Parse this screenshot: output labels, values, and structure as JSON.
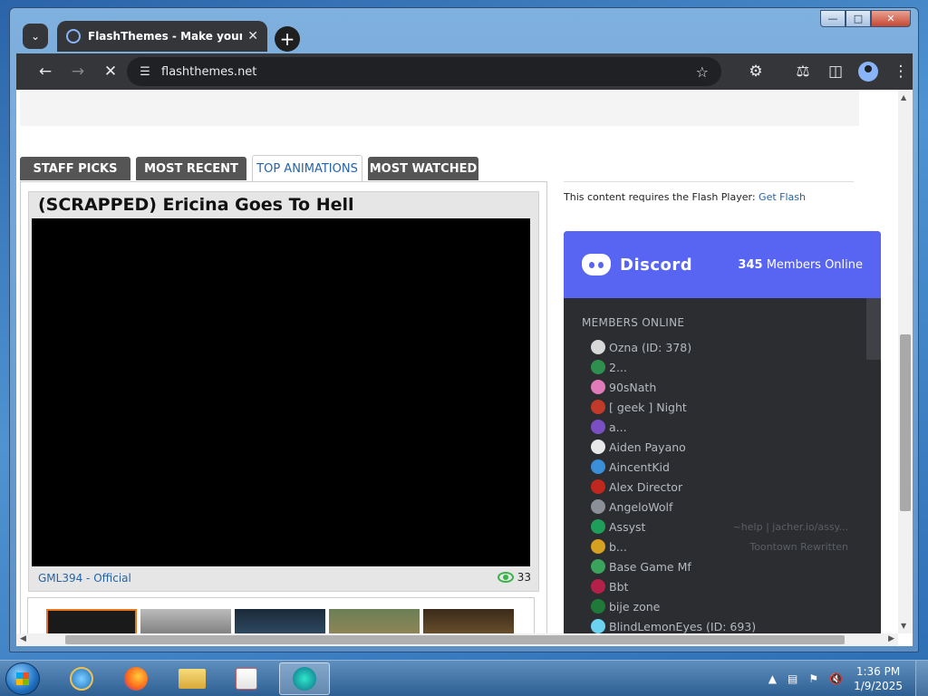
{
  "browser": {
    "tab_title": "FlashThemes - Make your own",
    "url": "flashthemes.net"
  },
  "site": {
    "tabs": [
      "STAFF PICKS",
      "MOST RECENT",
      "TOP ANIMATIONS",
      "MOST WATCHED"
    ],
    "active_tab": "TOP ANIMATIONS",
    "video": {
      "title": "(SCRAPPED) Ericina Goes To Hell",
      "author": "GML394 - Official",
      "views": "33"
    },
    "flash_message": "This content requires the Flash Player:",
    "flash_link": "Get Flash"
  },
  "discord": {
    "brand": "Discord",
    "online_count": "345",
    "online_label": "Members Online",
    "members_header": "MEMBERS ONLINE",
    "members": [
      {
        "name": "Ozna (ID: 378)",
        "activity": "",
        "color": "#d8d8d8"
      },
      {
        "name": "2...",
        "activity": "",
        "color": "#2f8f4e"
      },
      {
        "name": "90sNath",
        "activity": "",
        "color": "#e07ab8"
      },
      {
        "name": "[ geek ] Night",
        "activity": "",
        "color": "#c23b2a"
      },
      {
        "name": "a...",
        "activity": "",
        "color": "#7b4fc4"
      },
      {
        "name": "Aiden Payano",
        "activity": "",
        "color": "#e8e8e8"
      },
      {
        "name": "AincentKid",
        "activity": "",
        "color": "#3b8fd8"
      },
      {
        "name": "Alex Director",
        "activity": "",
        "color": "#c0271f"
      },
      {
        "name": "AngeloWolf",
        "activity": "",
        "color": "#8a8f98"
      },
      {
        "name": "Assyst",
        "activity": "~help | jacher.io/assy...",
        "color": "#1f9e5a"
      },
      {
        "name": "b...",
        "activity": "Toontown Rewritten",
        "color": "#d6a020"
      },
      {
        "name": "Base Game Mf",
        "activity": "",
        "color": "#3aa35c"
      },
      {
        "name": "Bbt",
        "activity": "",
        "color": "#b3204a"
      },
      {
        "name": "bije zone",
        "activity": "",
        "color": "#1f7a3a"
      },
      {
        "name": "BlindLemonEyes (ID: 693)",
        "activity": "",
        "color": "#6bd3f0"
      }
    ]
  },
  "taskbar": {
    "time": "1:36 PM",
    "date": "1/9/2025"
  }
}
